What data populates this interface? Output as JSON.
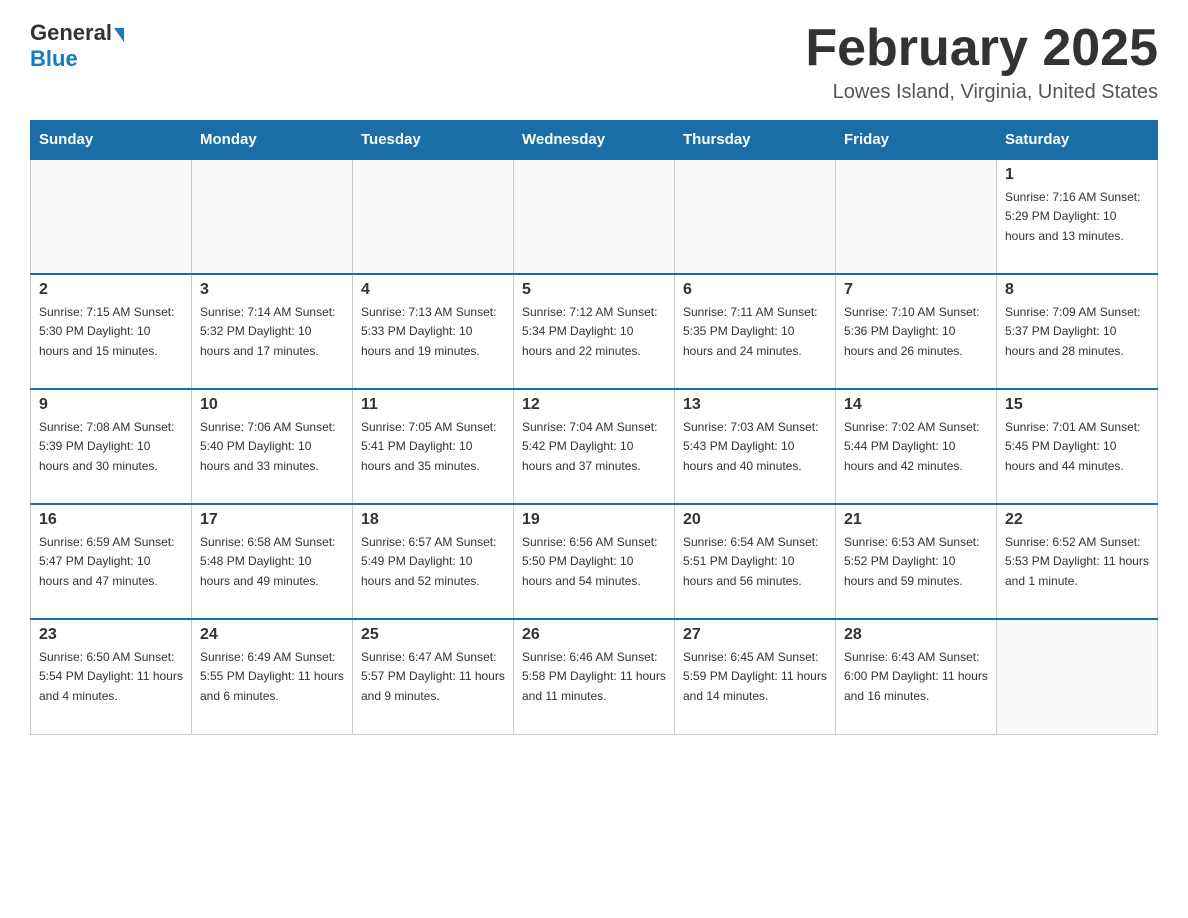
{
  "header": {
    "logo_general": "General",
    "logo_blue": "Blue",
    "month_title": "February 2025",
    "location": "Lowes Island, Virginia, United States"
  },
  "days_of_week": [
    "Sunday",
    "Monday",
    "Tuesday",
    "Wednesday",
    "Thursday",
    "Friday",
    "Saturday"
  ],
  "weeks": [
    [
      {
        "day": "",
        "info": ""
      },
      {
        "day": "",
        "info": ""
      },
      {
        "day": "",
        "info": ""
      },
      {
        "day": "",
        "info": ""
      },
      {
        "day": "",
        "info": ""
      },
      {
        "day": "",
        "info": ""
      },
      {
        "day": "1",
        "info": "Sunrise: 7:16 AM\nSunset: 5:29 PM\nDaylight: 10 hours and 13 minutes."
      }
    ],
    [
      {
        "day": "2",
        "info": "Sunrise: 7:15 AM\nSunset: 5:30 PM\nDaylight: 10 hours and 15 minutes."
      },
      {
        "day": "3",
        "info": "Sunrise: 7:14 AM\nSunset: 5:32 PM\nDaylight: 10 hours and 17 minutes."
      },
      {
        "day": "4",
        "info": "Sunrise: 7:13 AM\nSunset: 5:33 PM\nDaylight: 10 hours and 19 minutes."
      },
      {
        "day": "5",
        "info": "Sunrise: 7:12 AM\nSunset: 5:34 PM\nDaylight: 10 hours and 22 minutes."
      },
      {
        "day": "6",
        "info": "Sunrise: 7:11 AM\nSunset: 5:35 PM\nDaylight: 10 hours and 24 minutes."
      },
      {
        "day": "7",
        "info": "Sunrise: 7:10 AM\nSunset: 5:36 PM\nDaylight: 10 hours and 26 minutes."
      },
      {
        "day": "8",
        "info": "Sunrise: 7:09 AM\nSunset: 5:37 PM\nDaylight: 10 hours and 28 minutes."
      }
    ],
    [
      {
        "day": "9",
        "info": "Sunrise: 7:08 AM\nSunset: 5:39 PM\nDaylight: 10 hours and 30 minutes."
      },
      {
        "day": "10",
        "info": "Sunrise: 7:06 AM\nSunset: 5:40 PM\nDaylight: 10 hours and 33 minutes."
      },
      {
        "day": "11",
        "info": "Sunrise: 7:05 AM\nSunset: 5:41 PM\nDaylight: 10 hours and 35 minutes."
      },
      {
        "day": "12",
        "info": "Sunrise: 7:04 AM\nSunset: 5:42 PM\nDaylight: 10 hours and 37 minutes."
      },
      {
        "day": "13",
        "info": "Sunrise: 7:03 AM\nSunset: 5:43 PM\nDaylight: 10 hours and 40 minutes."
      },
      {
        "day": "14",
        "info": "Sunrise: 7:02 AM\nSunset: 5:44 PM\nDaylight: 10 hours and 42 minutes."
      },
      {
        "day": "15",
        "info": "Sunrise: 7:01 AM\nSunset: 5:45 PM\nDaylight: 10 hours and 44 minutes."
      }
    ],
    [
      {
        "day": "16",
        "info": "Sunrise: 6:59 AM\nSunset: 5:47 PM\nDaylight: 10 hours and 47 minutes."
      },
      {
        "day": "17",
        "info": "Sunrise: 6:58 AM\nSunset: 5:48 PM\nDaylight: 10 hours and 49 minutes."
      },
      {
        "day": "18",
        "info": "Sunrise: 6:57 AM\nSunset: 5:49 PM\nDaylight: 10 hours and 52 minutes."
      },
      {
        "day": "19",
        "info": "Sunrise: 6:56 AM\nSunset: 5:50 PM\nDaylight: 10 hours and 54 minutes."
      },
      {
        "day": "20",
        "info": "Sunrise: 6:54 AM\nSunset: 5:51 PM\nDaylight: 10 hours and 56 minutes."
      },
      {
        "day": "21",
        "info": "Sunrise: 6:53 AM\nSunset: 5:52 PM\nDaylight: 10 hours and 59 minutes."
      },
      {
        "day": "22",
        "info": "Sunrise: 6:52 AM\nSunset: 5:53 PM\nDaylight: 11 hours and 1 minute."
      }
    ],
    [
      {
        "day": "23",
        "info": "Sunrise: 6:50 AM\nSunset: 5:54 PM\nDaylight: 11 hours and 4 minutes."
      },
      {
        "day": "24",
        "info": "Sunrise: 6:49 AM\nSunset: 5:55 PM\nDaylight: 11 hours and 6 minutes."
      },
      {
        "day": "25",
        "info": "Sunrise: 6:47 AM\nSunset: 5:57 PM\nDaylight: 11 hours and 9 minutes."
      },
      {
        "day": "26",
        "info": "Sunrise: 6:46 AM\nSunset: 5:58 PM\nDaylight: 11 hours and 11 minutes."
      },
      {
        "day": "27",
        "info": "Sunrise: 6:45 AM\nSunset: 5:59 PM\nDaylight: 11 hours and 14 minutes."
      },
      {
        "day": "28",
        "info": "Sunrise: 6:43 AM\nSunset: 6:00 PM\nDaylight: 11 hours and 16 minutes."
      },
      {
        "day": "",
        "info": ""
      }
    ]
  ]
}
